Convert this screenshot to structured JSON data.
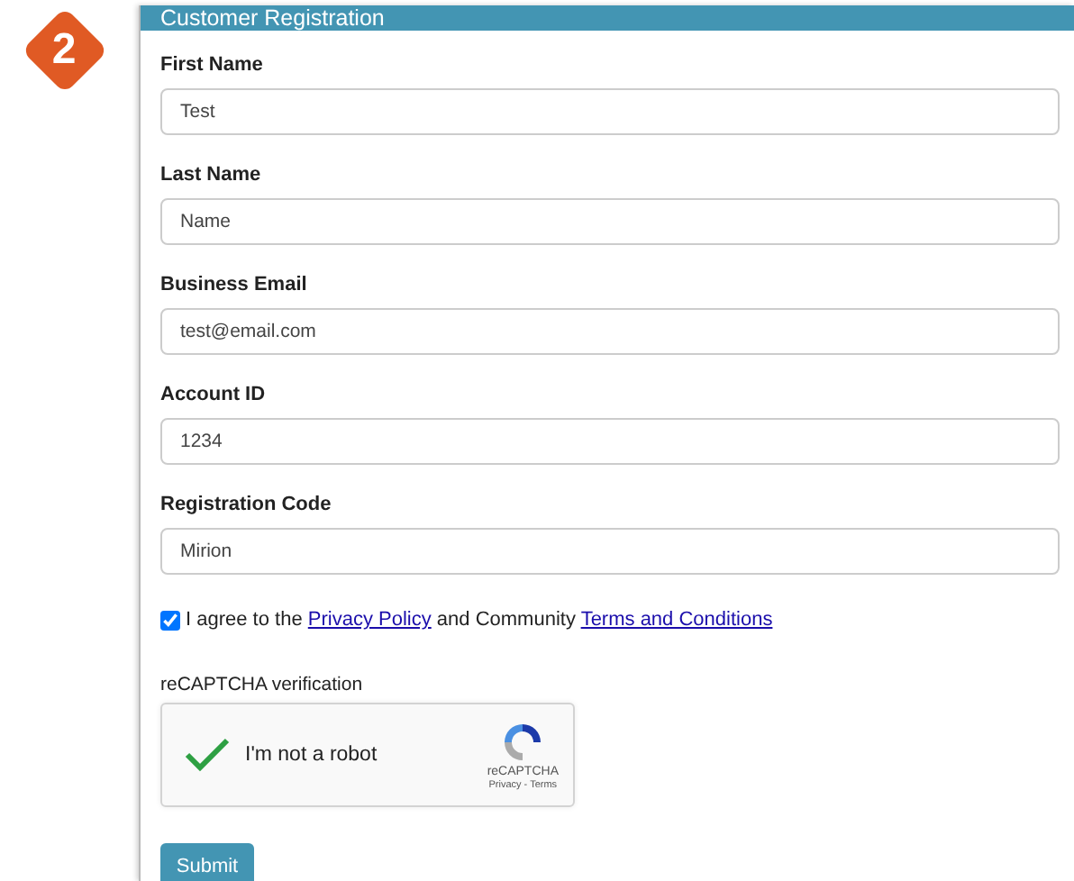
{
  "step_badge": "2",
  "panel": {
    "title": "Customer Registration"
  },
  "fields": [
    {
      "label": "First Name",
      "value": "Test"
    },
    {
      "label": "Last Name",
      "value": "Name"
    },
    {
      "label": "Business Email",
      "value": "test@email.com"
    },
    {
      "label": "Account ID",
      "value": "1234"
    },
    {
      "label": "Registration Code",
      "value": "Mirion"
    }
  ],
  "agreement": {
    "checked": true,
    "parts": [
      {
        "kind": "text",
        "text": "I agree to the "
      },
      {
        "kind": "link",
        "text": "Privacy Policy"
      },
      {
        "kind": "text",
        "text": " and Community "
      },
      {
        "kind": "link",
        "text": "Terms and Conditions"
      }
    ]
  },
  "captcha": {
    "label": "reCAPTCHA verification",
    "verified": true,
    "prompt": "I'm not a robot",
    "brand": "reCAPTCHA",
    "links": "Privacy - Terms"
  },
  "submit": "Submit"
}
